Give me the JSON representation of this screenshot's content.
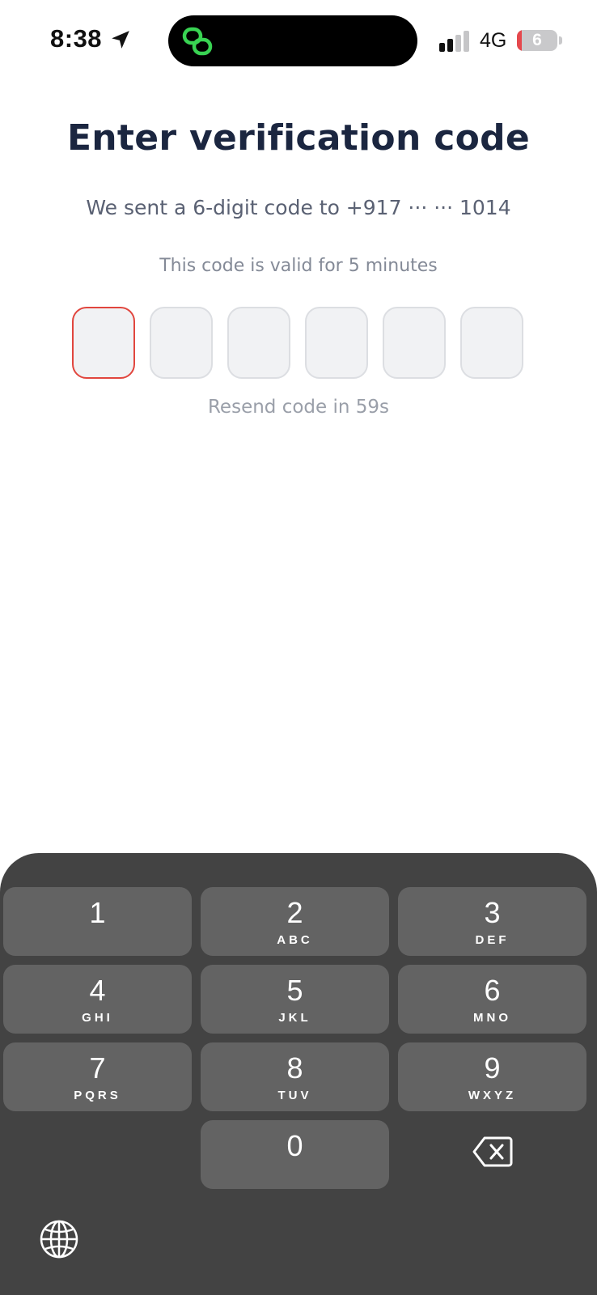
{
  "status_bar": {
    "time": "8:38",
    "network": "4G",
    "battery_level": "6",
    "battery_fraction": 0.06,
    "icons": [
      "location-arrow-icon",
      "app-link-icon",
      "cellular-signal-icon",
      "battery-icon"
    ]
  },
  "verification": {
    "title": "Enter verification code",
    "sent_message": "We sent a 6-digit code to +917 ··· ··· 1014",
    "validity_message": "This code is valid for 5 minutes",
    "resend_message": "Resend code in 59s",
    "code_boxes": [
      "",
      "",
      "",
      "",
      "",
      ""
    ],
    "active_box": 0
  },
  "keyboard": {
    "keys": [
      {
        "digit": "1",
        "letters": ""
      },
      {
        "digit": "2",
        "letters": "ABC"
      },
      {
        "digit": "3",
        "letters": "DEF"
      },
      {
        "digit": "4",
        "letters": "GHI"
      },
      {
        "digit": "5",
        "letters": "JKL"
      },
      {
        "digit": "6",
        "letters": "MNO"
      },
      {
        "digit": "7",
        "letters": "PQRS"
      },
      {
        "digit": "8",
        "letters": "TUV"
      },
      {
        "digit": "9",
        "letters": "WXYZ"
      },
      {
        "digit": "0",
        "letters": ""
      }
    ],
    "icons": [
      "delete-icon",
      "globe-icon"
    ]
  },
  "colors": {
    "title": "#1b2640",
    "active_border": "#e1463e",
    "keyboard_bg": "#434343",
    "key_bg": "#636363",
    "island_icon": "#39d353"
  }
}
